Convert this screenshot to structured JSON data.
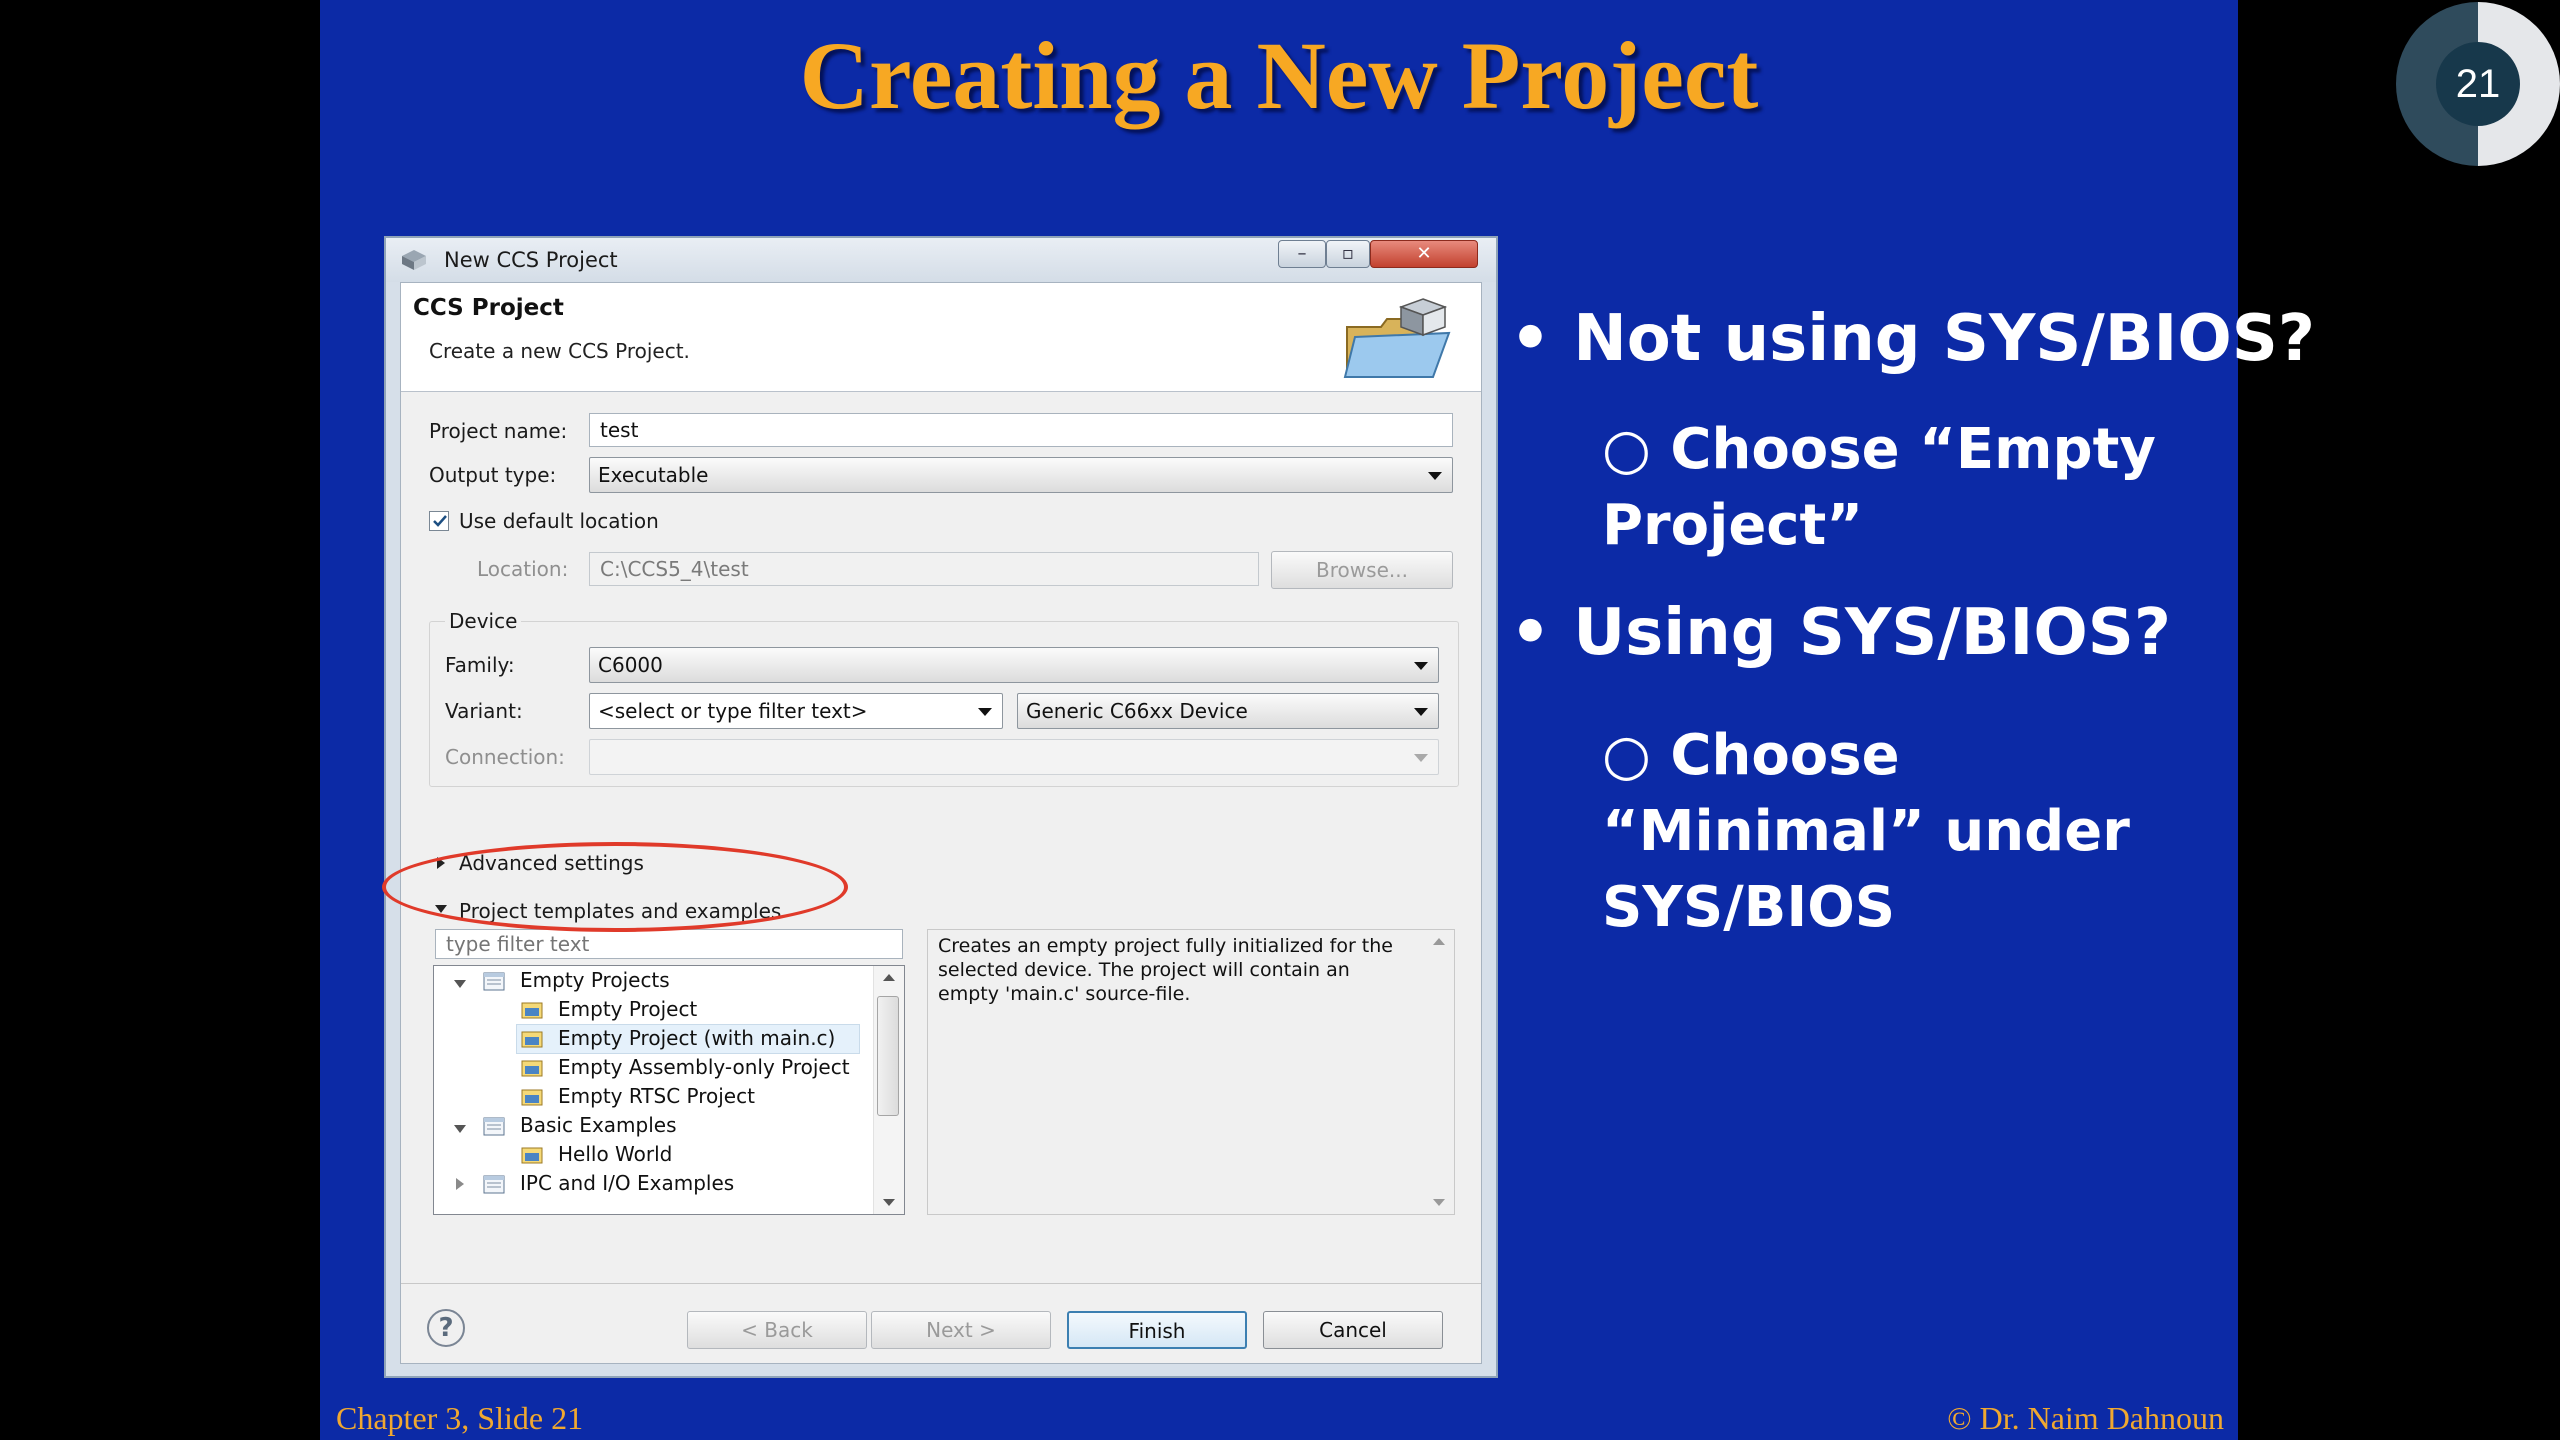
{
  "slide": {
    "title": "Creating a New Project",
    "bullets": [
      {
        "text": "• Not using SYS/BIOS?",
        "sub": "○ Choose “Empty Project”"
      },
      {
        "text": "• Using SYS/BIOS?",
        "sub": "○  Choose “Minimal” under SYS/BIOS"
      }
    ],
    "footer_left": "Chapter 3, Slide 21",
    "footer_right": "© Dr. Naim Dahnoun",
    "slide_number": "21"
  },
  "dialog": {
    "window_title": "New CCS Project",
    "header_title": "CCS Project",
    "header_subtitle": "Create a new CCS Project.",
    "project_name_label": "Project name:",
    "project_name_value": "test",
    "output_type_label": "Output type:",
    "output_type_value": "Executable",
    "use_default_location_label": "Use default location",
    "use_default_location_checked": true,
    "location_label": "Location:",
    "location_value": "C:\\CCS5_4\\test",
    "browse_label": "Browse...",
    "device_group_label": "Device",
    "family_label": "Family:",
    "family_value": "C6000",
    "variant_label": "Variant:",
    "variant_filter_value": "<select or type filter text>",
    "variant_value": "Generic C66xx Device",
    "connection_label": "Connection:",
    "connection_value": "",
    "advanced_settings_label": "Advanced settings",
    "templates_label": "Project templates and examples",
    "filter_placeholder": "type filter text",
    "tree": [
      {
        "label": "Empty Projects",
        "level": 0,
        "expanded": true
      },
      {
        "label": "Empty Project",
        "level": 1
      },
      {
        "label": "Empty Project (with main.c)",
        "level": 1,
        "selected": true
      },
      {
        "label": "Empty Assembly-only Project",
        "level": 1
      },
      {
        "label": "Empty RTSC Project",
        "level": 1
      },
      {
        "label": "Basic Examples",
        "level": 0,
        "expanded": true
      },
      {
        "label": "Hello World",
        "level": 1
      },
      {
        "label": "IPC and I/O Examples",
        "level": 0,
        "expanded": false
      }
    ],
    "description": "Creates an empty project fully initialized for the selected device. The project will contain an empty 'main.c' source-file.",
    "help_icon": "?",
    "back_label": "< Back",
    "next_label": "Next >",
    "finish_label": "Finish",
    "cancel_label": "Cancel"
  },
  "colors": {
    "slide_background": "#0c2aa6",
    "title_color": "#f7a823",
    "annotation_oval": "#e03a2a"
  },
  "icons": [
    "app-icon",
    "folder-cube-icon",
    "project-folder-icon",
    "help-icon",
    "minimize-icon",
    "maximize-icon",
    "close-icon"
  ]
}
